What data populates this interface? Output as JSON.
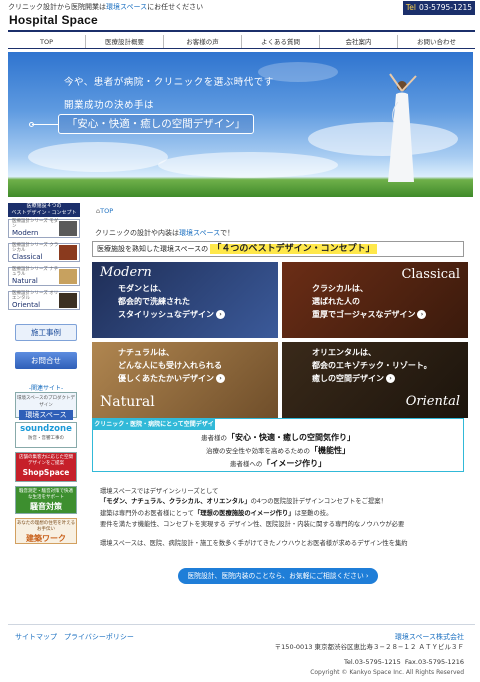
{
  "header": {
    "tagline_pre": "クリニック設計から医院開業は",
    "tagline_hl": "環境スペース",
    "tagline_post": "にお任せください",
    "logo": "Hospital Space",
    "tel_label": "Tel",
    "tel": "03-5795-1215"
  },
  "nav": [
    "TOP",
    "医療設計概要",
    "お客様の声",
    "よくある質問",
    "会社案内",
    "お問い合わせ"
  ],
  "hero": {
    "line1": "今や、患者が病院・クリニックを選ぶ時代です",
    "line2": "開業成功の決め手は",
    "line3": "「安心・快適・癒しの空間デザイン」"
  },
  "sidebar": {
    "title": "医療施設４つの\nベストデザイン・コンセプト",
    "series": [
      {
        "sub": "医療設計シリーズ モダン",
        "name": "Modern"
      },
      {
        "sub": "医療設計シリーズ クラシカル",
        "name": "Classical"
      },
      {
        "sub": "医療設計シリーズ ナチュラル",
        "name": "Natural"
      },
      {
        "sub": "医療設計シリーズ オリエンタル",
        "name": "Oriental"
      }
    ],
    "cases": "施工事例",
    "contact": "お問合せ",
    "related_header": "-関連サイト-",
    "related": [
      {
        "label": "環境スペース",
        "sub": "環境スペースのプロダクトデザイン"
      },
      {
        "label": "soundzone",
        "sub": "防音・音響工事の"
      },
      {
        "label": "ShopSpace",
        "sub": "店舗の集客力に応じた空間デザインをご提案"
      },
      {
        "label": "騒音対策",
        "sub": "騒音測定・騒音対策で快適な生活をサポート"
      },
      {
        "label": "建築ワーク",
        "sub": "あなたの理想の住宅を叶えるお手伝い"
      }
    ]
  },
  "main": {
    "breadcrumb": "TOP",
    "intro_pre": "クリニックの設計や内装は",
    "intro_hl": "環境スペース",
    "intro_post": "で！",
    "concept_pre": "医療施設を熟知した環境スペースの",
    "concept_big": "「４つのベストデザイン・コンセプト」",
    "tiles": [
      {
        "name": "Modern",
        "l1": "モダンとは、",
        "l2": "都会的で洗練された",
        "l3": "スタイリッシュなデザイン"
      },
      {
        "name": "Classical",
        "l1": "クラシカルは、",
        "l2": "選ばれた人の",
        "l3": "重厚でゴージャスなデザイン"
      },
      {
        "name": "Natural",
        "l1": "ナチュラルは、",
        "l2": "どんな人にも受け入れられる",
        "l3": "優しくあたたかいデザイン"
      },
      {
        "name": "Oriental",
        "l1": "オリエンタルは、",
        "l2": "都会のエキゾチック・リゾート。",
        "l3": "癒しの空間デザイン"
      }
    ],
    "cyan": {
      "header": "クリニック・医院・病院にとって空間デザインは",
      "r1_pre": "患者様の",
      "r1_big": "「安心・快適・癒しの空間気作り」",
      "r2_pre": "治療の安全性や効率を高めるための",
      "r2_big": "「機能性」",
      "r3_pre": "患者様への",
      "r3_big": "「イメージ作り」"
    },
    "p1": "環境スペースではデザインシリーズとして",
    "p2_bold": "「モダン、ナチュラル、クラシカル、オリエンタル」",
    "p2_post": "の4つの医院設計デザインコンセプトをご提案！",
    "p3_pre": "建築は専門外のお医者様にとって",
    "p3_bold": "「理想の医療施設のイメージ作り」",
    "p3_post": "は至難の技。",
    "p4": "要件を満たす機能性、コンセプトを実現する デザイン性、医院設計・内装に関する専門的なノウハウが必要",
    "p5": "環境スペースは、医院、病院設計・施工を数多く手がけてきたノウハウとお医者様が求めるデザイン性を集約",
    "cta": "医院設計、医院内装のことなら、お気軽にご相談ください"
  },
  "footer": {
    "links": [
      "サイトマップ",
      "プライバシーポリシー"
    ],
    "company": "環境スペース株式会社",
    "address": "〒150-0013 東京都渋谷区恵比寿３−２８−１２ ＡＴＹビル３Ｆ",
    "tel": "Tel.03-5795-1215",
    "fax": "Fax.03-5795-1216",
    "copyright": "Copyright © Kankyo Space Inc. All Rights Reserved"
  },
  "colors": {
    "navy": "#1b2f6b",
    "link": "#1a6fc0",
    "cyan": "#31b9d8",
    "yellow": "#ffe84a"
  }
}
